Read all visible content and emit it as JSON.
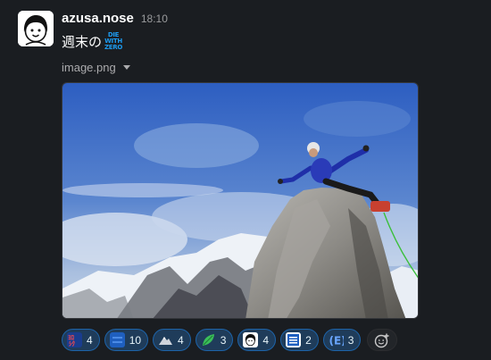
{
  "message": {
    "username": "azusa.nose",
    "timestamp": "18:10",
    "text": "週末の",
    "inline_emoji": {
      "name": "die-with-zero-emoji",
      "lines": [
        "DIE",
        "WITH",
        "ZERO"
      ],
      "color": "#1d9bf0"
    },
    "attachment": {
      "file_name": "image.png"
    }
  },
  "reactions": [
    {
      "icon": "lettered-emoji-red-blue",
      "count": "4"
    },
    {
      "icon": "blue-square-emoji",
      "count": "10"
    },
    {
      "icon": "mountain-emoji",
      "count": "4"
    },
    {
      "icon": "green-leaf-emoji",
      "count": "3"
    },
    {
      "icon": "face-avatar-emoji",
      "count": "4"
    },
    {
      "icon": "kanji-badge-emoji",
      "count": "2"
    },
    {
      "icon": "letter-e-emoji",
      "count": "3"
    }
  ],
  "colors": {
    "background": "#1a1d21",
    "reaction_bg": "#1f3c5a",
    "reaction_border": "#1d63a8",
    "accent": "#1d9bf0"
  }
}
